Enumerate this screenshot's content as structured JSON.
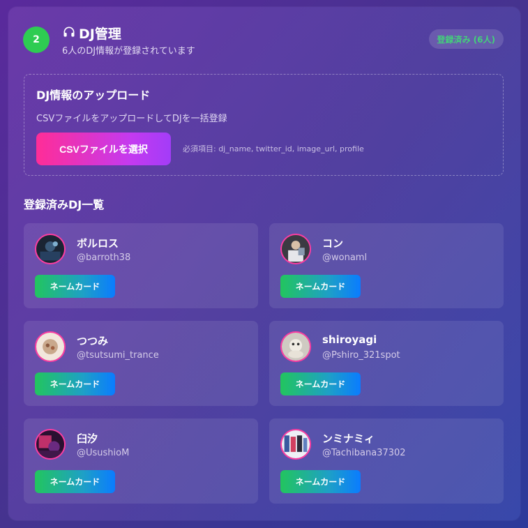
{
  "header": {
    "step": "2",
    "title": "DJ管理",
    "subtitle": "6人のDJ情報が登録されています",
    "badge": "登録済み (6人)",
    "title_icon": "headphones-icon"
  },
  "upload": {
    "title": "DJ情報のアップロード",
    "description": "CSVファイルをアップロードしてDJを一括登録",
    "button_label": "CSVファイルを選択",
    "required_fields": "必須項目: dj_name, twitter_id, image_url, profile"
  },
  "list": {
    "title": "登録済みDJ一覧",
    "name_card_label": "ネームカード",
    "djs": [
      {
        "name": "ボルロス",
        "handle": "@barroth38"
      },
      {
        "name": "コン",
        "handle": "@wonaml"
      },
      {
        "name": "つつみ",
        "handle": "@tsutsumi_trance"
      },
      {
        "name": "shiroyagi",
        "handle": "@Pshiro_321spot"
      },
      {
        "name": "臼汐",
        "handle": "@UsushioM"
      },
      {
        "name": "ンミナミィ",
        "handle": "@Tachibana37302"
      }
    ]
  },
  "colors": {
    "step_green": "#2ecc52",
    "accent_pink": "#ff2d97",
    "accent_purple": "#a33cf8",
    "badge_text": "#43d27a",
    "card_button_start": "#22c55e",
    "card_button_end": "#0a7cff"
  }
}
